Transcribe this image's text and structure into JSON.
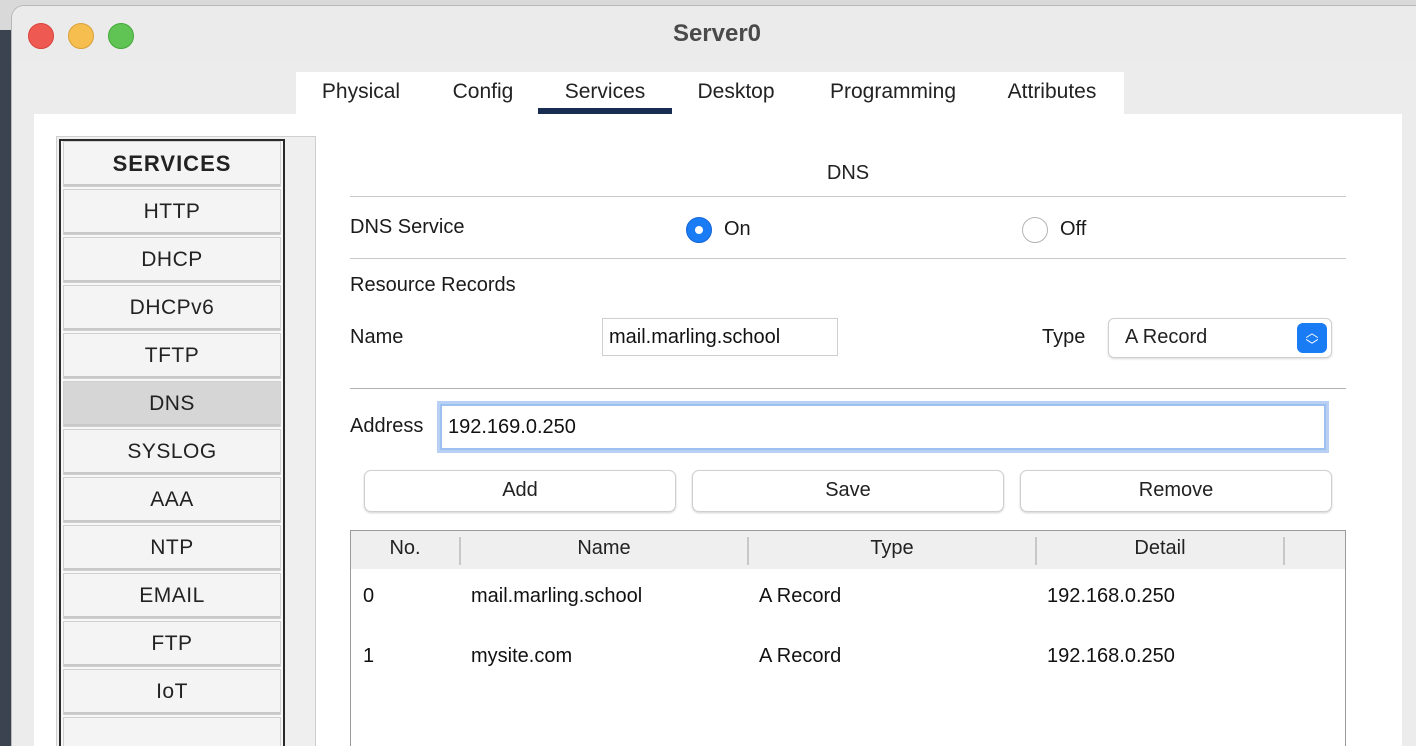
{
  "window": {
    "title": "Server0"
  },
  "tabs": [
    {
      "label": "Physical"
    },
    {
      "label": "Config"
    },
    {
      "label": "Services"
    },
    {
      "label": "Desktop"
    },
    {
      "label": "Programming"
    },
    {
      "label": "Attributes"
    }
  ],
  "active_tab": "Services",
  "sidebar": {
    "header": "SERVICES",
    "items": [
      {
        "label": "HTTP"
      },
      {
        "label": "DHCP"
      },
      {
        "label": "DHCPv6"
      },
      {
        "label": "TFTP"
      },
      {
        "label": "DNS"
      },
      {
        "label": "SYSLOG"
      },
      {
        "label": "AAA"
      },
      {
        "label": "NTP"
      },
      {
        "label": "EMAIL"
      },
      {
        "label": "FTP"
      },
      {
        "label": "IoT"
      }
    ],
    "active": "DNS"
  },
  "dns": {
    "title": "DNS",
    "service_label": "DNS Service",
    "on_label": "On",
    "off_label": "Off",
    "service_state": "On",
    "resource_records_label": "Resource Records",
    "name_label": "Name",
    "name_value": "mail.marling.school",
    "type_label": "Type",
    "type_value": "A Record",
    "address_label": "Address",
    "address_value": "192.169.0.250",
    "add_button": "Add",
    "save_button": "Save",
    "remove_button": "Remove",
    "table": {
      "headers": [
        "No.",
        "Name",
        "Type",
        "Detail"
      ],
      "rows": [
        {
          "no": "0",
          "name": "mail.marling.school",
          "type": "A Record",
          "detail": "192.168.0.250"
        },
        {
          "no": "1",
          "name": "mysite.com",
          "type": "A Record",
          "detail": "192.168.0.250"
        }
      ]
    }
  },
  "colors": {
    "accent": "#1a7cf5",
    "tab_underline": "#172d52",
    "close": "#ee5a52",
    "minimize": "#f5be4f",
    "zoom": "#5fc454"
  }
}
